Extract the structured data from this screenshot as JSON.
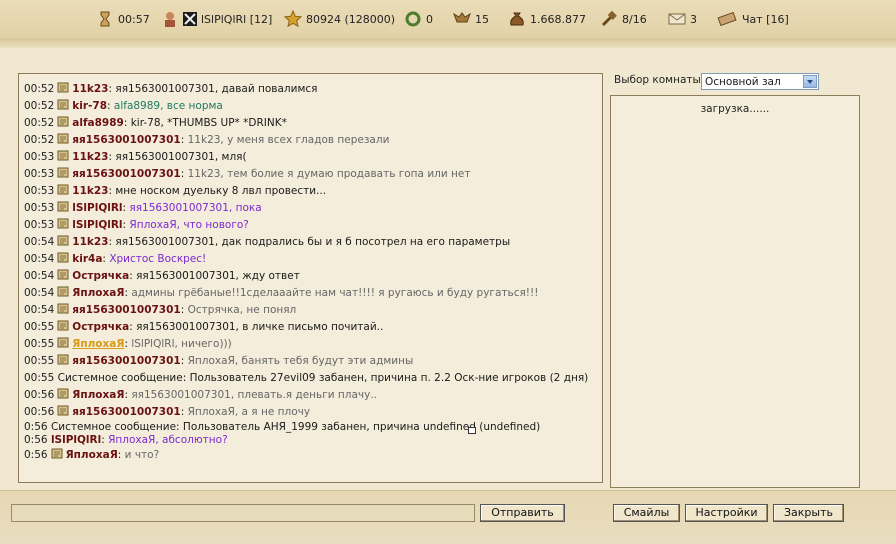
{
  "topbar": {
    "timer": "00:57",
    "player": "lSlPlQlRl [12]",
    "experience": "80924 (128000)",
    "laurels": "0",
    "army": "15",
    "gold": "1.668.877",
    "loot": "8/16",
    "mail": "3",
    "chat": "Чат [16]"
  },
  "chat": {
    "messages": [
      {
        "time": "00:52",
        "nick": "11k23",
        "text": "яя1563001007301, давай повалимся",
        "style": "normal"
      },
      {
        "time": "00:52",
        "nick": "kir-78",
        "text": "alfa8989, все норма",
        "style": "green"
      },
      {
        "time": "00:52",
        "nick": "alfa8989",
        "text": "kir-78, *THUMBS UP* *DRINK*",
        "style": "normal"
      },
      {
        "time": "00:52",
        "nick": "яя1563001007301",
        "text": "11k23, у меня всех гладов перезали",
        "style": "grey"
      },
      {
        "time": "00:53",
        "nick": "11k23",
        "text": "яя1563001007301, мля(",
        "style": "normal"
      },
      {
        "time": "00:53",
        "nick": "яя1563001007301",
        "text": "11k23, тем болие я думаю продавать гопа или нет",
        "style": "grey"
      },
      {
        "time": "00:53",
        "nick": "11k23",
        "text": "мне носком дуельку 8 лвл провести...",
        "style": "normal"
      },
      {
        "time": "00:53",
        "nick": "lSlPlQlRl",
        "text": "яя1563001007301, пока",
        "style": "purple"
      },
      {
        "time": "00:53",
        "nick": "lSlPlQlRl",
        "text": "ЯплохаЯ, что нового?",
        "style": "purple"
      },
      {
        "time": "00:54",
        "nick": "11k23",
        "text": "яя1563001007301, дак подрались бы и я б посотрел на его параметры",
        "style": "normal"
      },
      {
        "time": "00:54",
        "nick": "kir4a",
        "text": "Христос Воскрес!",
        "style": "purple"
      },
      {
        "time": "00:54",
        "nick": "Острячка",
        "text": "яя1563001007301, жду ответ",
        "style": "normal"
      },
      {
        "time": "00:54",
        "nick": "ЯплохаЯ",
        "text": "админы грёбаные!!1сделааайте нам чат!!!! я ругаюсь и буду ругаться!!!",
        "style": "grey"
      },
      {
        "time": "00:54",
        "nick": "яя1563001007301",
        "text": "Острячка, не понял",
        "style": "grey"
      },
      {
        "time": "00:55",
        "nick": "Острячка",
        "text": "яя1563001007301, в личке письмо почитай..",
        "style": "normal"
      },
      {
        "time": "00:55",
        "nick": "ЯплохаЯ",
        "text": "lSlPlQlRl, ничего)))",
        "style": "grey",
        "highlight": true
      },
      {
        "time": "00:55",
        "nick": "яя1563001007301",
        "text": "ЯплохаЯ, банять тебя будут эти админы",
        "style": "grey"
      }
    ],
    "system1": {
      "time": "00:55",
      "text": "Системное сообщение: Пользователь 27evil09 забанен, причина п. 2.2 Оск-ние игроков (2 дня)"
    },
    "after_system": [
      {
        "time": "00:56",
        "nick": "ЯплохаЯ",
        "text": "яя1563001007301, плевать.я деньги плачу..",
        "style": "grey"
      },
      {
        "time": "00:56",
        "nick": "яя1563001007301",
        "text": "ЯплохаЯ, а я не плочу",
        "style": "grey"
      }
    ],
    "system2": {
      "time": "0:56",
      "text": "Системное сообщение: Пользователь АНЯ_1999 забанен, причина undefined (undefined)"
    },
    "tail1": {
      "time": "0:56",
      "nick": "lSlPlQlRl",
      "text": "ЯплохаЯ, абсолютно?"
    },
    "tail2": {
      "time": "0:56",
      "nick": "ЯплохаЯ",
      "text": "и что?"
    }
  },
  "room": {
    "label": "Выбор комнаты:",
    "selected": "Основной зал",
    "loading": "загрузка......"
  },
  "buttons": {
    "send": "Отправить",
    "smileys": "Смайлы",
    "settings": "Настройки",
    "close": "Закрыть"
  },
  "colors": {
    "nick": "#6a1111",
    "purple": "#7a2ad0",
    "green": "#1e7a63",
    "highlight": "#d79a16"
  }
}
